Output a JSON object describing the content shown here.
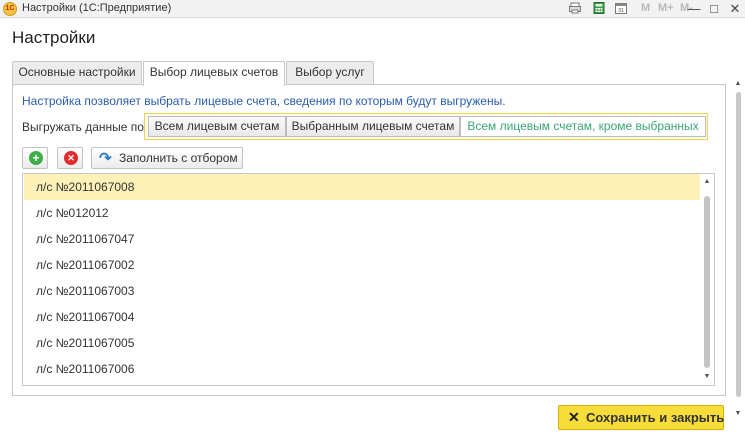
{
  "window": {
    "logo_text": "1С",
    "title": "Настройки  (1С:Предприятие)",
    "m_labels": [
      "M",
      "M+",
      "M-"
    ],
    "minimize": "—",
    "maximize": "□",
    "close": "✕"
  },
  "page": {
    "heading": "Настройки"
  },
  "tabs": [
    {
      "label": "Основные настройки"
    },
    {
      "label": "Выбор лицевых счетов"
    },
    {
      "label": "Выбор услуг"
    }
  ],
  "active_tab": 1,
  "content": {
    "info_text": "Настройка позволяет выбрать лицевые счета, сведения по которым будут выгружены.",
    "unload_label": "Выгружать данные по:",
    "options": [
      {
        "label": "Всем лицевым счетам"
      },
      {
        "label": "Выбранным лицевым счетам"
      },
      {
        "label": "Всем лицевым счетам, кроме выбранных"
      }
    ],
    "selected_option": 2
  },
  "toolbar": {
    "add_glyph": "+",
    "delete_glyph": "✕",
    "fill_label": "Заполнить с отбором",
    "fill_icon": "↷"
  },
  "accounts": [
    "л/с №2011067008",
    "л/с №012012",
    "л/с №2011067047",
    "л/с №2011067002",
    "л/с №2011067003",
    "л/с №2011067004",
    "л/с №2011067005",
    "л/с №2011067006"
  ],
  "selected_account": 0,
  "scroll_arrows": {
    "up": "▲",
    "down": "▼"
  },
  "footer": {
    "save_icon": "✕",
    "save_label": "Сохранить и закрыть"
  },
  "colors": {
    "info_text": "#2a5db0",
    "selected_option_text": "#3aa577",
    "selected_row": "#fdf1b8",
    "save_button": "#f7dc3a",
    "add_icon": "#3fae49",
    "delete_icon": "#e02c2c",
    "fill_icon": "#2d7bc4"
  }
}
